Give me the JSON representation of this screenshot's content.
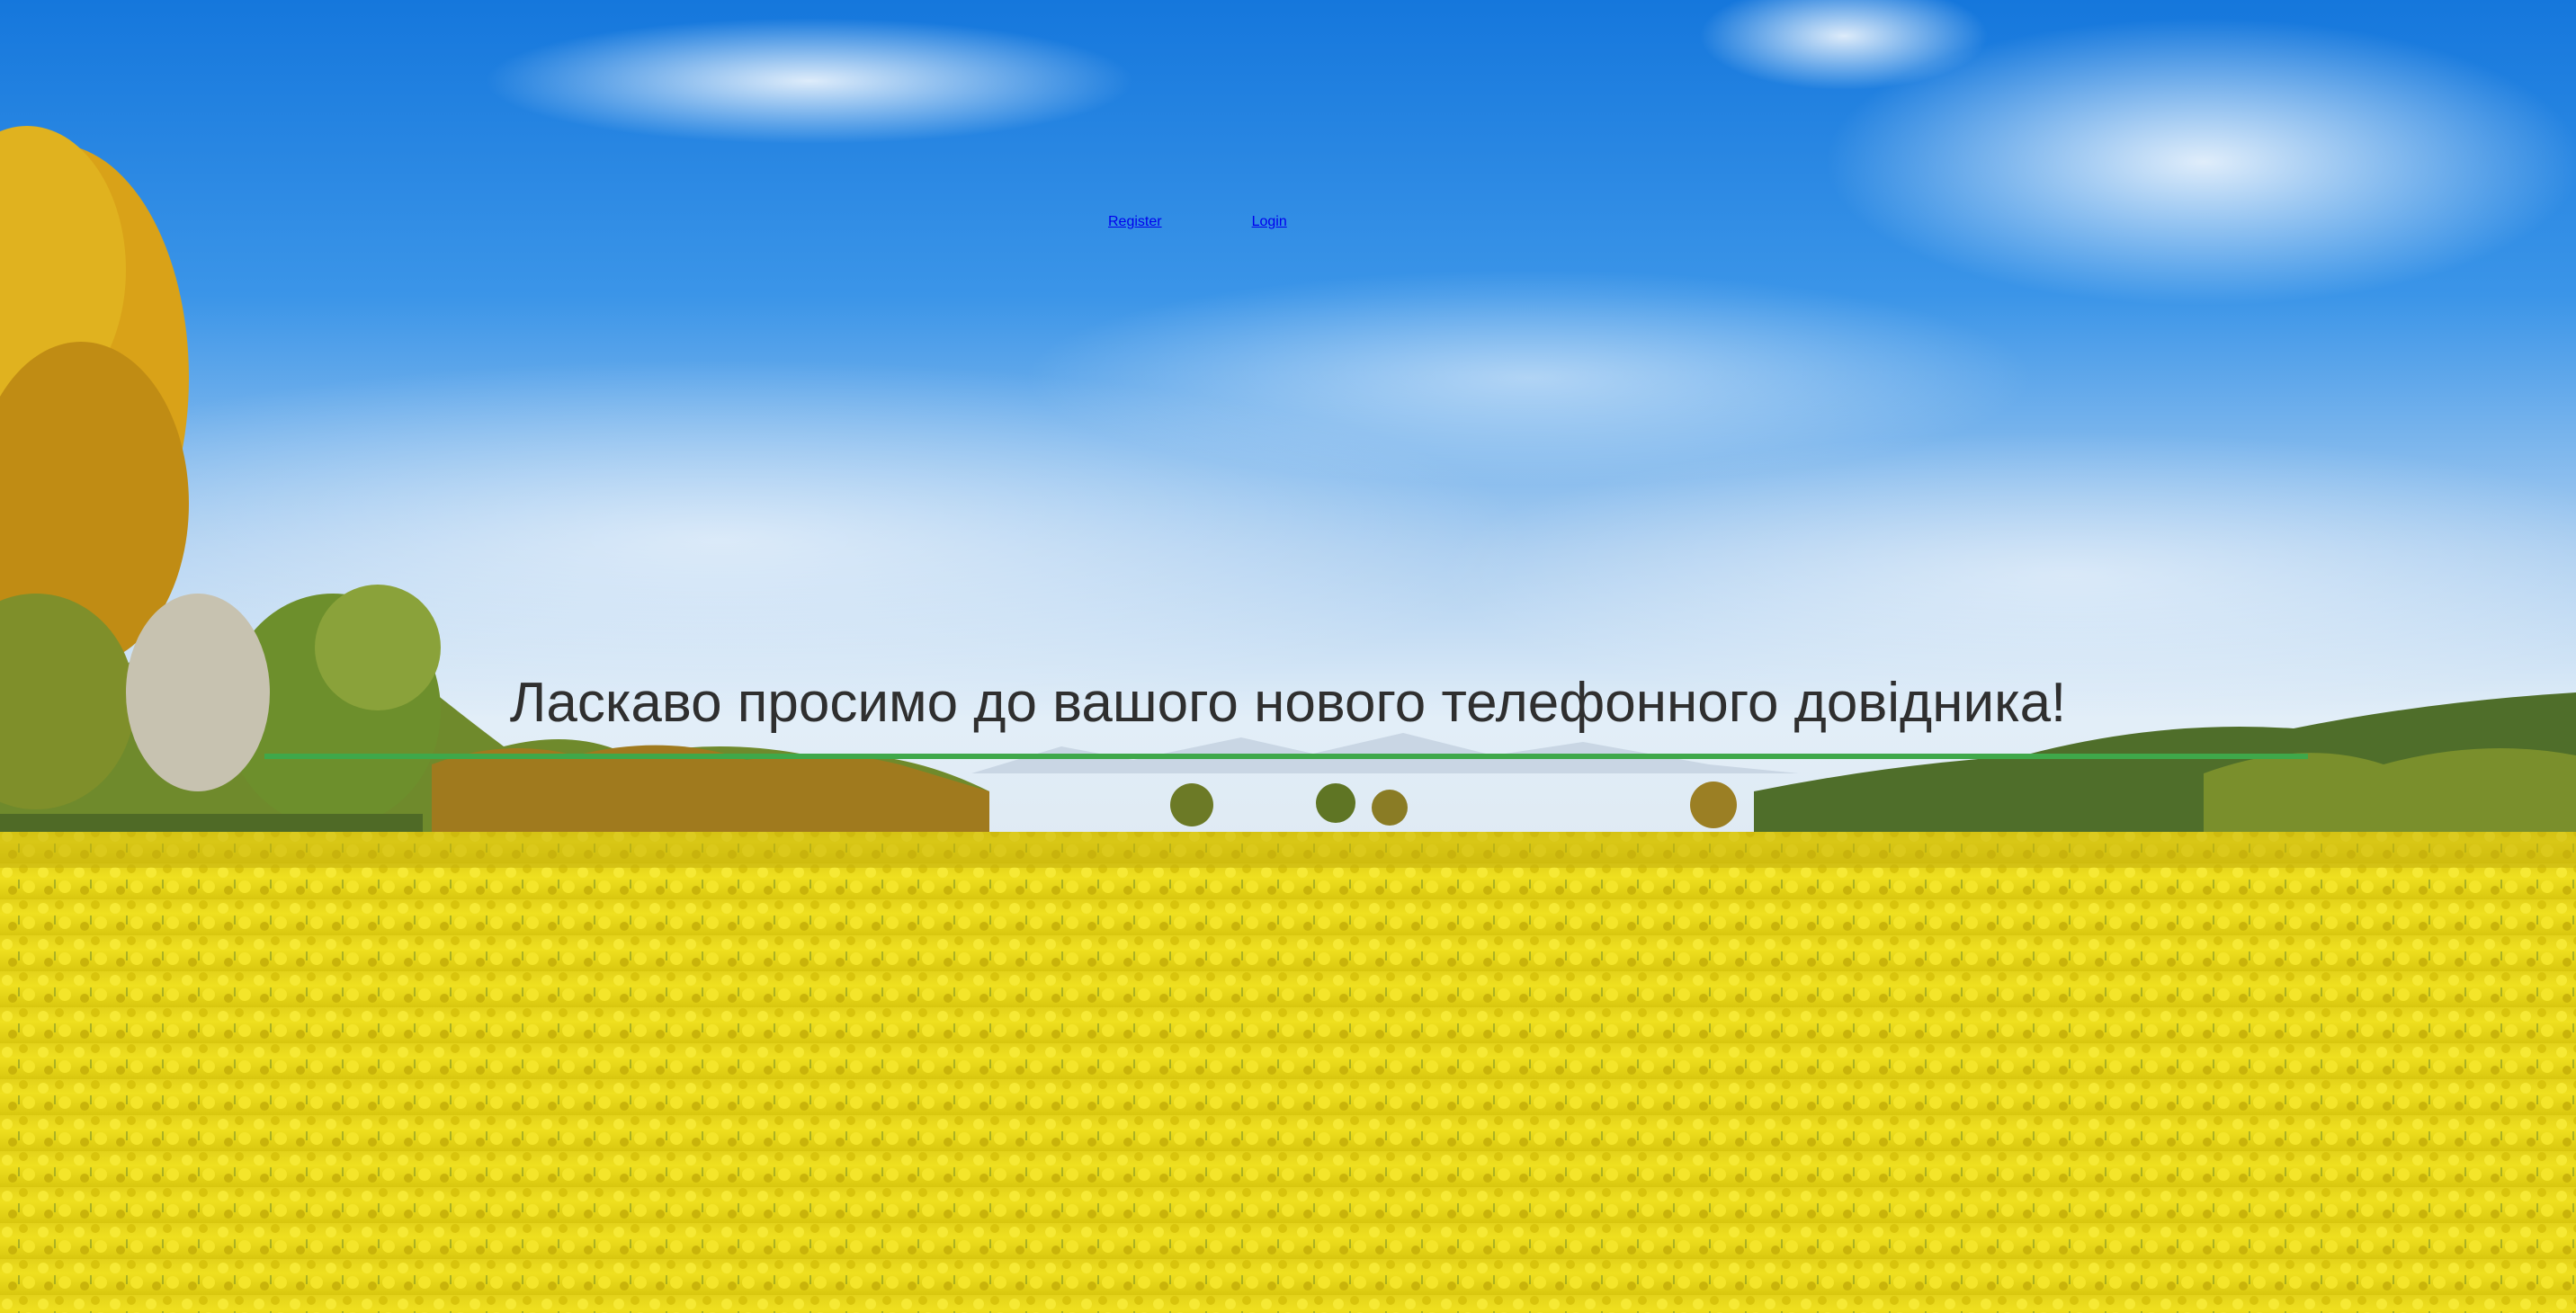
{
  "nav": {
    "register_label": "Register",
    "login_label": "Login"
  },
  "hero": {
    "title": "Ласкаво просимо до вашого нового телефонного довідника!"
  },
  "colors": {
    "underline": "#3fa84a",
    "sky_top": "#1a7fe0",
    "field_yellow": "#f1e21a"
  },
  "background": {
    "image_description_icon": "landscape-image"
  }
}
